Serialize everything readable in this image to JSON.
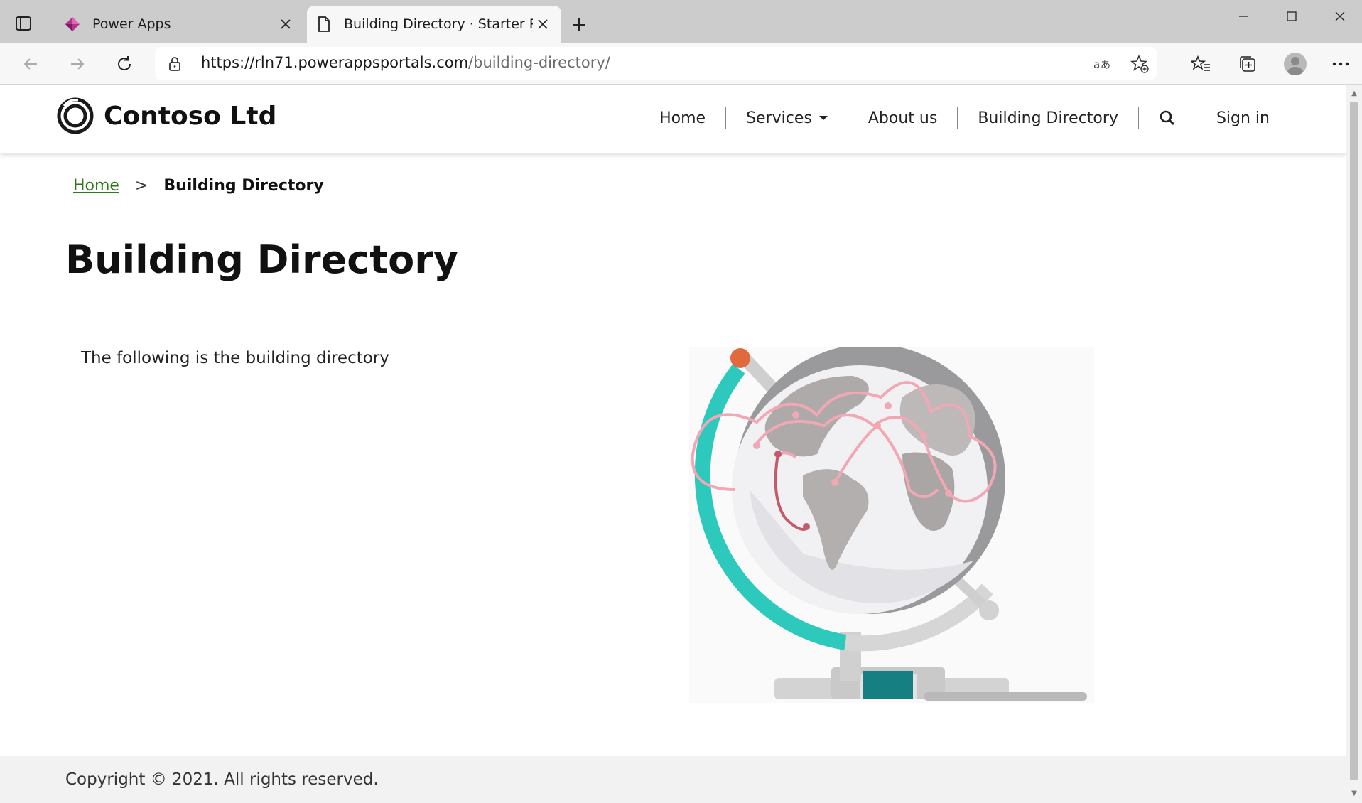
{
  "browser": {
    "tabs": [
      {
        "title": "Power Apps",
        "active": false,
        "icon": "power-apps-icon"
      },
      {
        "title": "Building Directory · Starter Portal",
        "active": true,
        "icon": "page-icon"
      }
    ],
    "url": {
      "host": "https://rln71.powerappsportals.com",
      "path": "/building-directory/"
    }
  },
  "site": {
    "brand": "Contoso Ltd",
    "nav": {
      "home": "Home",
      "services": "Services",
      "about": "About us",
      "directory": "Building Directory",
      "signin": "Sign in"
    }
  },
  "breadcrumb": {
    "home": "Home",
    "separator": ">",
    "current": "Building Directory"
  },
  "page": {
    "title": "Building Directory",
    "intro": "The following is the building directory"
  },
  "footer": {
    "copyright": "Copyright © 2021. All rights reserved."
  },
  "colors": {
    "breadcrumb_link": "#2c7a1b",
    "globe_teal": "#2ec9bd",
    "globe_route": "#f2a7b5",
    "globe_dot": "#e06a3e"
  }
}
